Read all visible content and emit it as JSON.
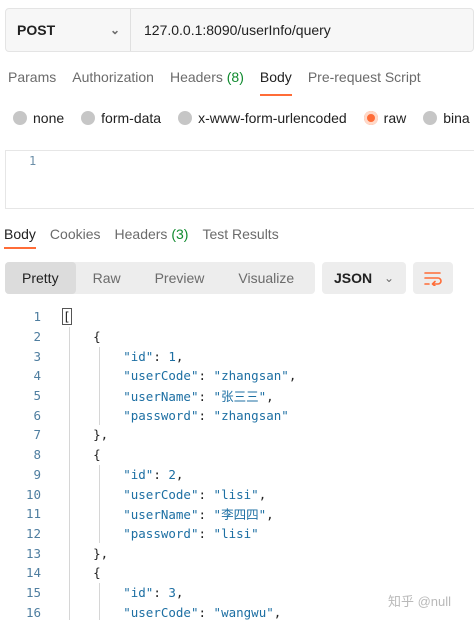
{
  "request": {
    "method": "POST",
    "url": "127.0.0.1:8090/userInfo/query"
  },
  "request_tabs": [
    {
      "label": "Params"
    },
    {
      "label": "Authorization"
    },
    {
      "label": "Headers",
      "count": "(8)"
    },
    {
      "label": "Body",
      "active": true
    },
    {
      "label": "Pre-request Script"
    }
  ],
  "body_types": [
    "none",
    "form-data",
    "x-www-form-urlencoded",
    "raw",
    "bina"
  ],
  "body_type_selected": "raw",
  "editor": {
    "line": "1"
  },
  "response_tabs": [
    {
      "label": "Body",
      "active": true
    },
    {
      "label": "Cookies"
    },
    {
      "label": "Headers",
      "count": "(3)"
    },
    {
      "label": "Test Results"
    }
  ],
  "view_modes": [
    "Pretty",
    "Raw",
    "Preview",
    "Visualize"
  ],
  "view_mode_selected": "Pretty",
  "format": "JSON",
  "colors": {
    "accent": "#ff6c37",
    "count_green": "#0f8a2e",
    "json_key": "#1d6fa3"
  },
  "code_lines": [
    {
      "n": "1",
      "text": "["
    },
    {
      "n": "2",
      "text": "    {"
    },
    {
      "n": "3",
      "text": "        \"id\": 1,"
    },
    {
      "n": "4",
      "text": "        \"userCode\": \"zhangsan\","
    },
    {
      "n": "5",
      "text": "        \"userName\": \"张三三\","
    },
    {
      "n": "6",
      "text": "        \"password\": \"zhangsan\""
    },
    {
      "n": "7",
      "text": "    },"
    },
    {
      "n": "8",
      "text": "    {"
    },
    {
      "n": "9",
      "text": "        \"id\": 2,"
    },
    {
      "n": "10",
      "text": "        \"userCode\": \"lisi\","
    },
    {
      "n": "11",
      "text": "        \"userName\": \"李四四\","
    },
    {
      "n": "12",
      "text": "        \"password\": \"lisi\""
    },
    {
      "n": "13",
      "text": "    },"
    },
    {
      "n": "14",
      "text": "    {"
    },
    {
      "n": "15",
      "text": "        \"id\": 3,"
    },
    {
      "n": "16",
      "text": "        \"userCode\": \"wangwu\","
    }
  ],
  "watermark": "知乎 @null"
}
